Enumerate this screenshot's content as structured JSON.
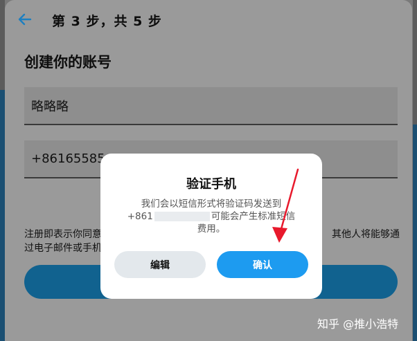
{
  "header": {
    "step_text": "第 3 步，共 5 步"
  },
  "form": {
    "title": "创建你的账号",
    "name_value": "略略略",
    "phone_value": "+86165585"
  },
  "terms": {
    "line1_left": "注册即表示你同意",
    "line1_right": "其他人将能够通",
    "line2_left": "过电子邮件或手机"
  },
  "dialog": {
    "title": "验证手机",
    "line1": "我们会以短信形式将验证码发送到",
    "line2_prefix": "+861",
    "line2_suffix": "可能会产生标准短信",
    "line3": "费用。",
    "edit_label": "编辑",
    "confirm_label": "确认"
  },
  "annotation": {
    "arrow_color": "#e8192c"
  },
  "watermark": "知乎 @推小浩特"
}
